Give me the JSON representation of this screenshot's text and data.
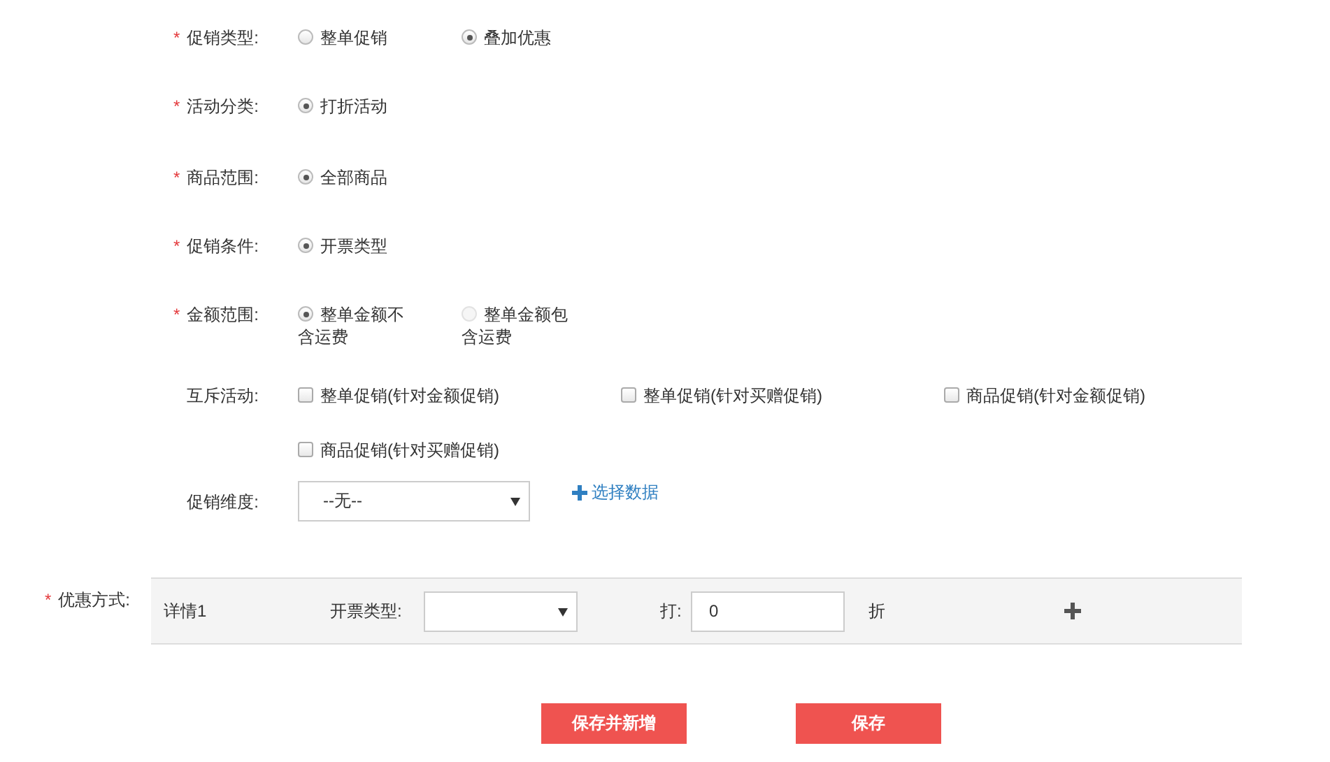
{
  "fields": [
    {
      "kind": "radio",
      "required_mark": "*",
      "label": "促销类型:",
      "options": [
        {
          "label": "整单促销",
          "selected": false,
          "disabled": false
        },
        {
          "label": "叠加优惠",
          "selected": true,
          "disabled": false
        }
      ]
    },
    {
      "kind": "radio",
      "required_mark": "*",
      "label": "活动分类:",
      "options": [
        {
          "label": "打折活动",
          "selected": true,
          "disabled": false
        }
      ]
    },
    {
      "kind": "radio",
      "required_mark": "*",
      "label": "商品范围:",
      "options": [
        {
          "label": "全部商品",
          "selected": true,
          "disabled": false
        }
      ]
    },
    {
      "kind": "radio",
      "required_mark": "*",
      "label": "促销条件:",
      "options": [
        {
          "label": "开票类型",
          "selected": true,
          "disabled": false
        }
      ]
    },
    {
      "kind": "radio",
      "required_mark": "*",
      "label": "金额范围:",
      "options": [
        {
          "label": "整单金额不含运费",
          "selected": true,
          "disabled": false
        },
        {
          "label": "整单金额包含运费",
          "selected": false,
          "disabled": true
        }
      ]
    },
    {
      "kind": "checkbox",
      "label": "互斥活动:",
      "options": [
        {
          "label": "整单促销(针对金额促销)",
          "checked": false
        },
        {
          "label": "整单促销(针对买赠促销)",
          "checked": false
        },
        {
          "label": "商品促销(针对金额促销)",
          "checked": false
        },
        {
          "label": "商品促销(针对买赠促销)",
          "checked": false
        }
      ]
    },
    {
      "kind": "select",
      "label": "促销维度:",
      "value": "--无--",
      "link": "选择数据"
    }
  ],
  "discount": {
    "required_mark": "*",
    "label": "优惠方式:",
    "rows": [
      {
        "title": "详情1",
        "type_label": "开票类型:",
        "rate_label": "打:",
        "rate_value": "0",
        "unit": "折"
      }
    ]
  },
  "buttons": [
    {
      "label": "保存并新增"
    },
    {
      "label": "保存"
    }
  ]
}
